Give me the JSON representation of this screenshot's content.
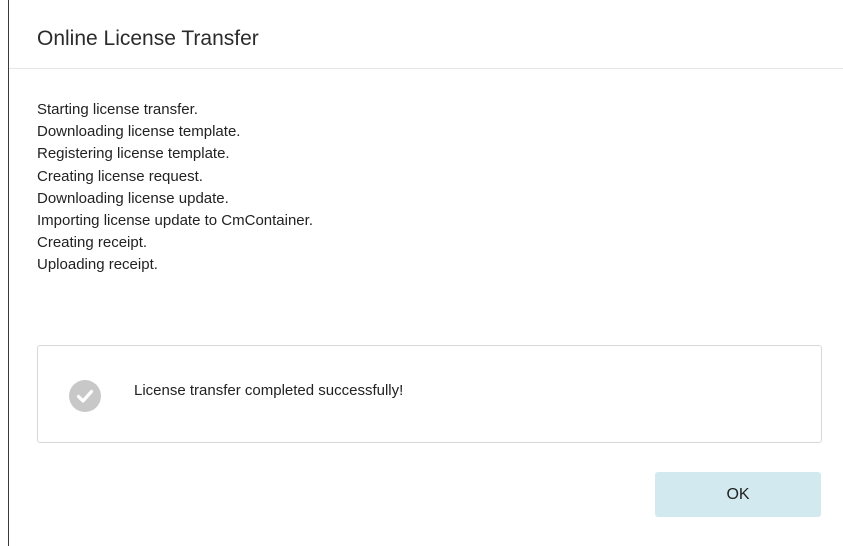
{
  "dialog": {
    "title": "Online License Transfer",
    "log_lines": [
      "Starting license transfer.",
      "Downloading license template.",
      "Registering license template.",
      "Creating license request.",
      "Downloading license update.",
      "Importing license update to CmContainer.",
      "Creating receipt.",
      "Uploading receipt."
    ],
    "status": {
      "icon": "check-circle-icon",
      "message": "License transfer completed successfully!"
    },
    "ok_label": "OK"
  },
  "colors": {
    "ok_button_bg": "#d3e9f0",
    "status_icon_bg": "#c8c8c8",
    "border": "#d8d8d8"
  }
}
